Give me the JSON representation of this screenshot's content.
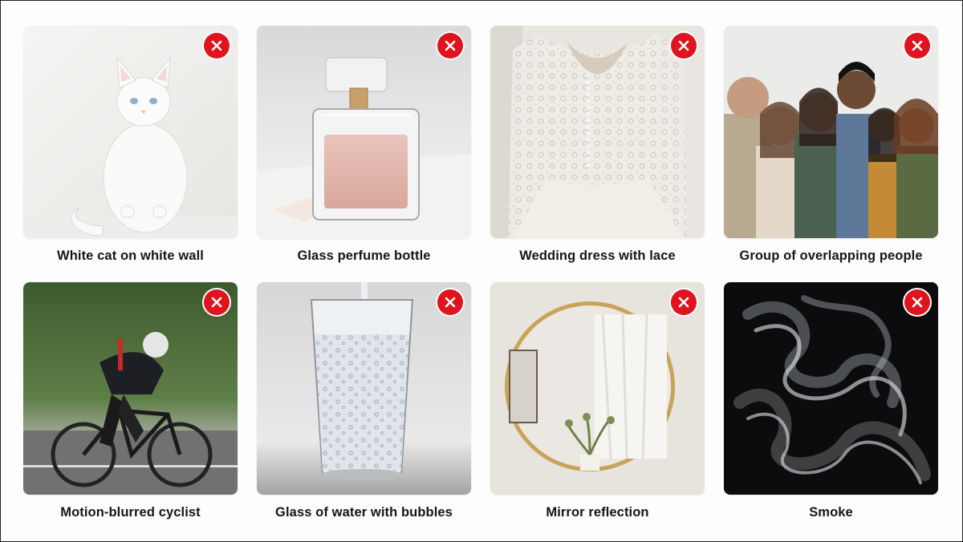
{
  "cards": [
    {
      "label": "White cat on white wall",
      "icon": "reject-x-icon",
      "image": "white-cat-on-white-wall-photo"
    },
    {
      "label": "Glass perfume bottle",
      "icon": "reject-x-icon",
      "image": "glass-perfume-bottle-photo"
    },
    {
      "label": "Wedding dress with lace",
      "icon": "reject-x-icon",
      "image": "wedding-dress-lace-photo"
    },
    {
      "label": "Group of overlapping people",
      "icon": "reject-x-icon",
      "image": "group-of-people-photo"
    },
    {
      "label": "Motion-blurred cyclist",
      "icon": "reject-x-icon",
      "image": "motion-blurred-cyclist-photo"
    },
    {
      "label": "Glass of water with bubbles",
      "icon": "reject-x-icon",
      "image": "glass-of-water-photo"
    },
    {
      "label": "Mirror reflection",
      "icon": "reject-x-icon",
      "image": "round-mirror-photo"
    },
    {
      "label": "Smoke",
      "icon": "reject-x-icon",
      "image": "smoke-photo"
    }
  ],
  "colors": {
    "badge": "#e0141e",
    "caption_text": "#161616",
    "frame_border": "#1f1f1f"
  }
}
